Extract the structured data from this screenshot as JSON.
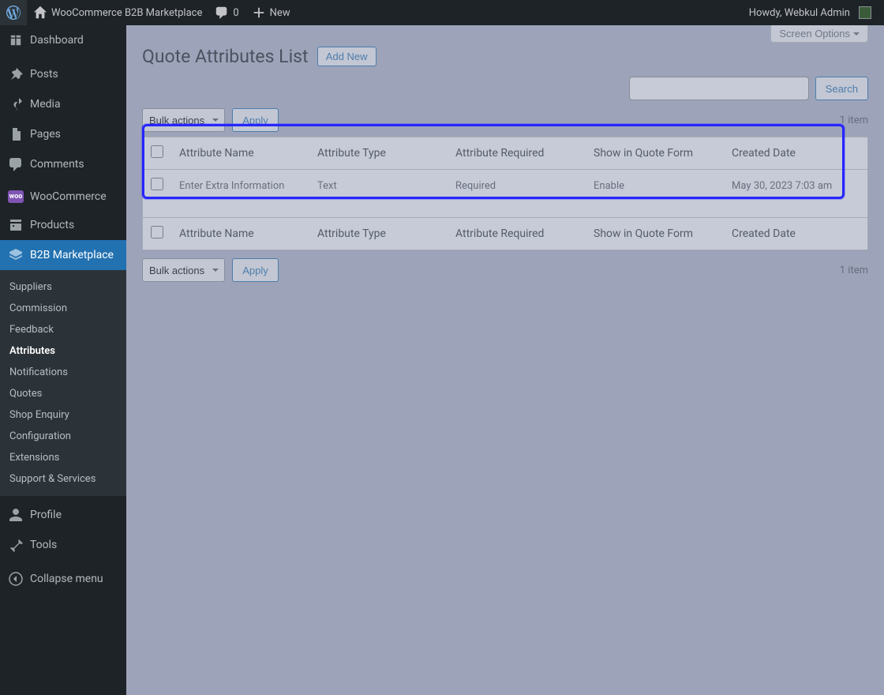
{
  "adminbar": {
    "site_name": "WooCommerce B2B Marketplace",
    "comments": "0",
    "new_label": "New",
    "howdy": "Howdy, Webkul Admin"
  },
  "menu": {
    "dashboard": "Dashboard",
    "posts": "Posts",
    "media": "Media",
    "pages": "Pages",
    "comments": "Comments",
    "woocommerce": "WooCommerce",
    "products": "Products",
    "b2b": "B2B Marketplace",
    "profile": "Profile",
    "tools": "Tools",
    "collapse": "Collapse menu"
  },
  "submenu": {
    "suppliers": "Suppliers",
    "commission": "Commission",
    "feedback": "Feedback",
    "attributes": "Attributes",
    "notifications": "Notifications",
    "quotes": "Quotes",
    "shop_enquiry": "Shop Enquiry",
    "configuration": "Configuration",
    "extensions": "Extensions",
    "support": "Support & Services"
  },
  "page": {
    "screen_options": "Screen Options",
    "title": "Quote Attributes List",
    "add_new": "Add New",
    "search": "Search",
    "bulk_actions": "Bulk actions",
    "apply": "Apply",
    "item_count": "1 item"
  },
  "table": {
    "headers": {
      "name": "Attribute Name",
      "type": "Attribute Type",
      "required": "Attribute Required",
      "show": "Show in Quote Form",
      "created": "Created Date"
    },
    "rows": [
      {
        "name": "Enter Extra Information",
        "type": "Text",
        "required": "Required",
        "show": "Enable",
        "created": "May 30, 2023 7:03 am"
      }
    ]
  }
}
